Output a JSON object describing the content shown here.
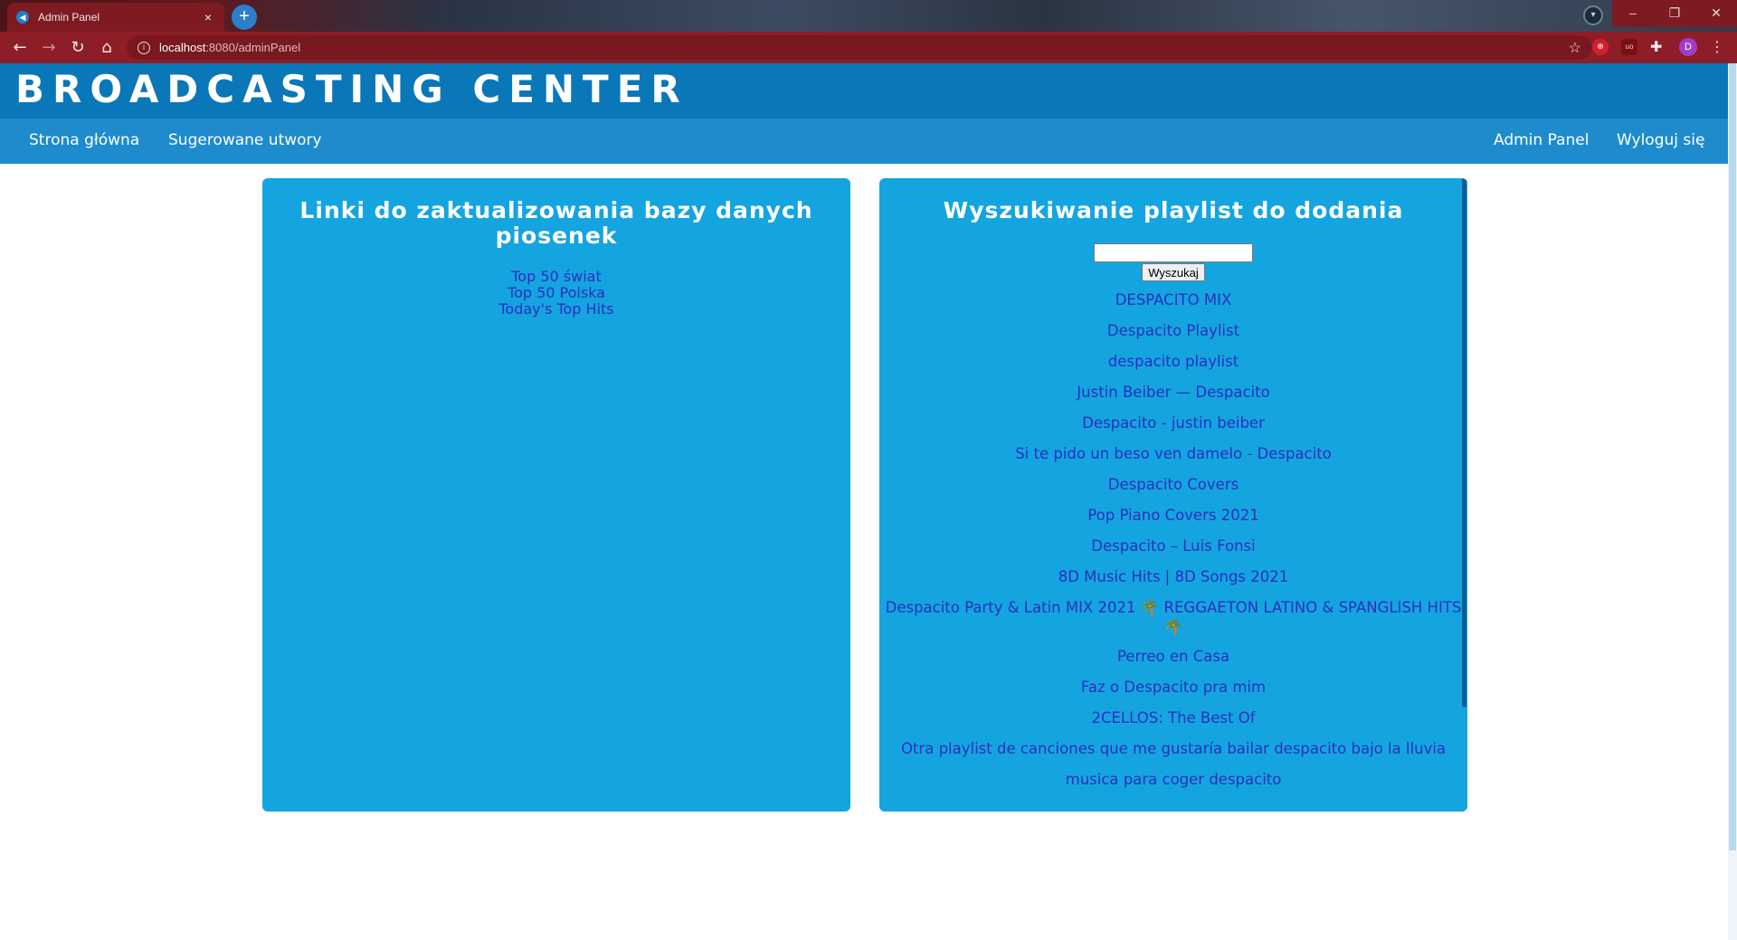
{
  "browser": {
    "tab_title": "Admin Panel",
    "tab_close": "×",
    "new_tab": "+",
    "url_host": "localhost",
    "url_rest": ":8080/adminPanel",
    "avatar_letter": "D",
    "ext_ub": "uo",
    "win_min": "–",
    "win_max": "❐",
    "win_close": "✕"
  },
  "site": {
    "title": "BROADCASTING CENTER"
  },
  "nav": {
    "home": "Strona główna",
    "suggested": "Sugerowane utwory",
    "admin": "Admin Panel",
    "logout": "Wyloguj się"
  },
  "left_panel": {
    "title": "Linki do zaktualizowania bazy danych piosenek",
    "links": [
      "Top 50 świat",
      "Top 50 Polska",
      "Today's Top Hits"
    ]
  },
  "right_panel": {
    "title": "Wyszukiwanie playlist do dodania",
    "search_value": "",
    "search_button": "Wyszukaj",
    "results": [
      "DESPACITO MIX",
      "Despacito Playlist",
      "despacito playlist",
      "Justin Beiber — Despacito",
      "Despacito - justin beiber",
      "Si te pido un beso ven damelo - Despacito",
      "Despacito Covers",
      "Pop Piano Covers 2021",
      "Despacito – Luis Fonsi",
      "8D Music Hits | 8D Songs 2021",
      "Despacito Party & Latin MIX 2021 🌴 REGGAETON LATINO & SPANGLISH HITS 🌴",
      "Perreo en Casa",
      "Faz o Despacito pra mim",
      "2CELLOS: The Best Of",
      "Otra playlist de canciones que me gustaría bailar despacito bajo la lluvia",
      "musica para coger despacito"
    ]
  },
  "colors": {
    "header": "#0a77b8",
    "nav": "#1e8ccc",
    "panel": "#14a5e0",
    "link": "#2a2fbf",
    "browser_bar": "#8d1e27"
  },
  "icons": [
    "back-arrow-icon",
    "forward-arrow-icon",
    "reload-icon",
    "home-icon",
    "info-icon",
    "star-icon",
    "puzzle-icon",
    "kebab-menu-icon"
  ]
}
